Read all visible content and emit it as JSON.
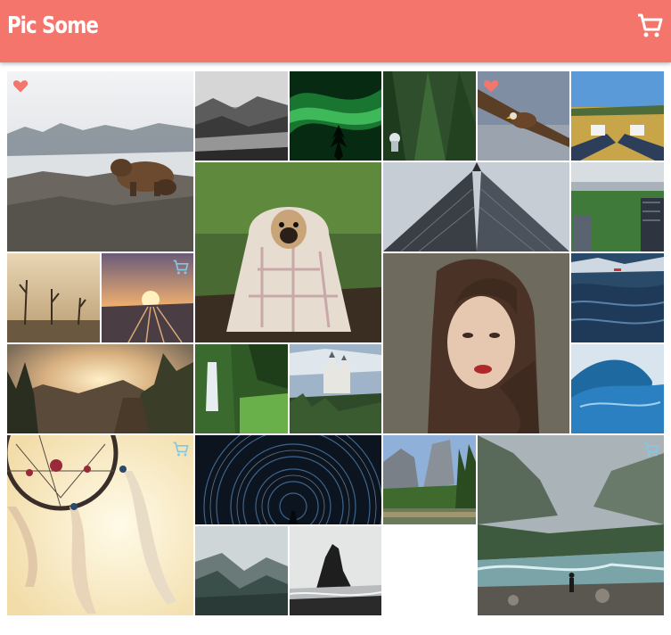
{
  "header": {
    "title": "Pic Some",
    "cart_icon": "cart-icon",
    "background_color": "#f4756b"
  },
  "colors": {
    "favorite": "#f4756b",
    "cart_hint": "#7fc8e8"
  },
  "gallery": {
    "photos": [
      {
        "id": "photo-bear",
        "scene": "bear-on-rocks",
        "favorite": true,
        "in_cart": false
      },
      {
        "id": "photo-foggy-forest",
        "scene": "foggy-forest",
        "favorite": false,
        "in_cart": false
      },
      {
        "id": "photo-aurora",
        "scene": "aurora",
        "favorite": false,
        "in_cart": false
      },
      {
        "id": "photo-pine-forest",
        "scene": "pine-forest",
        "favorite": false,
        "in_cart": false
      },
      {
        "id": "photo-eagle",
        "scene": "eagle",
        "favorite": true,
        "in_cart": false
      },
      {
        "id": "photo-legs-field",
        "scene": "legs-in-field",
        "favorite": false,
        "in_cart": false
      },
      {
        "id": "photo-pug-blanket",
        "scene": "pug-in-blanket",
        "favorite": false,
        "in_cart": false
      },
      {
        "id": "photo-skyscraper",
        "scene": "skyscraper",
        "favorite": false,
        "in_cart": false
      },
      {
        "id": "photo-city-park",
        "scene": "city-park",
        "favorite": false,
        "in_cart": false
      },
      {
        "id": "photo-dead-trees",
        "scene": "dead-trees-fog",
        "favorite": false,
        "in_cart": false
      },
      {
        "id": "photo-railway-sunset",
        "scene": "railway-sunset",
        "favorite": false,
        "in_cart": true
      },
      {
        "id": "photo-woman-portrait",
        "scene": "woman-portrait",
        "favorite": false,
        "in_cart": false
      },
      {
        "id": "photo-ocean-boat",
        "scene": "ocean-boat",
        "favorite": false,
        "in_cart": false
      },
      {
        "id": "photo-sunset-valley",
        "scene": "sunset-valley",
        "favorite": false,
        "in_cart": false
      },
      {
        "id": "photo-waterfall",
        "scene": "waterfall",
        "favorite": false,
        "in_cart": false
      },
      {
        "id": "photo-castle",
        "scene": "castle",
        "favorite": false,
        "in_cart": false
      },
      {
        "id": "photo-wave",
        "scene": "wave",
        "favorite": false,
        "in_cart": false
      },
      {
        "id": "photo-dreamcatcher",
        "scene": "dreamcatcher",
        "favorite": false,
        "in_cart": true
      },
      {
        "id": "photo-star-trails",
        "scene": "star-trails",
        "favorite": false,
        "in_cart": false
      },
      {
        "id": "photo-yosemite",
        "scene": "yosemite-cliffs",
        "favorite": false,
        "in_cart": false
      },
      {
        "id": "photo-river-mist",
        "scene": "river-mist",
        "favorite": false,
        "in_cart": true
      },
      {
        "id": "photo-misty-mountains",
        "scene": "misty-mountains",
        "favorite": false,
        "in_cart": false
      },
      {
        "id": "photo-sea-stack",
        "scene": "sea-stack",
        "favorite": false,
        "in_cart": false
      }
    ]
  }
}
